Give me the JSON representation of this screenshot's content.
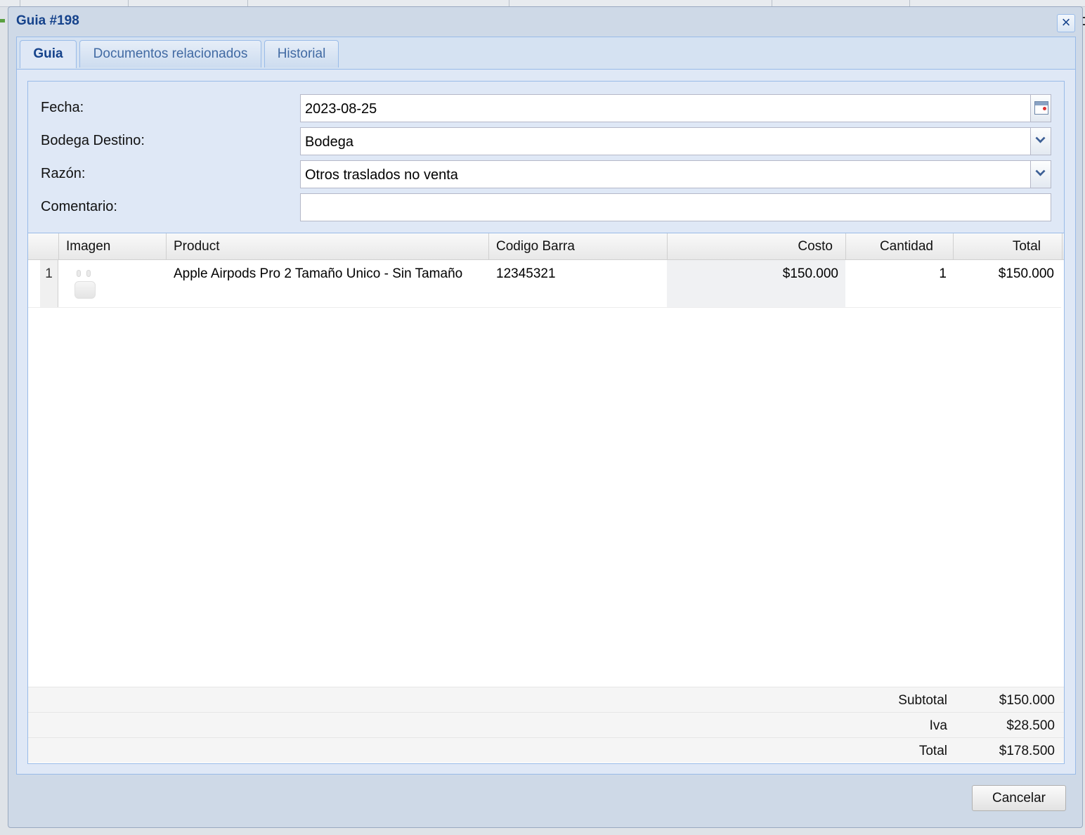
{
  "window": {
    "title": "Guia #198",
    "close_icon": "close-icon"
  },
  "tabs": [
    {
      "label": "Guia",
      "active": true
    },
    {
      "label": "Documentos relacionados",
      "active": false
    },
    {
      "label": "Historial",
      "active": false
    }
  ],
  "form": {
    "fecha": {
      "label": "Fecha:",
      "value": "2023-08-25",
      "icon": "calendar-icon"
    },
    "bodega": {
      "label": "Bodega Destino:",
      "value": "Bodega",
      "icon": "chevron-down-icon"
    },
    "razon": {
      "label": "Razón:",
      "value": "Otros traslados no venta",
      "icon": "chevron-down-icon"
    },
    "comentario": {
      "label": "Comentario:",
      "value": ""
    }
  },
  "grid": {
    "columns": [
      "",
      "Imagen",
      "Product",
      "Codigo Barra",
      "Costo",
      "Cantidad",
      "Total"
    ],
    "rows": [
      {
        "num": "1",
        "image": "airpods-thumbnail",
        "product": "Apple Airpods Pro 2 Tamaño Unico - Sin Tamaño",
        "barcode": "12345321",
        "costo": "$150.000",
        "cantidad": "1",
        "total": "$150.000"
      }
    ]
  },
  "summary": {
    "subtotal_label": "Subtotal",
    "subtotal": "$150.000",
    "iva_label": "Iva",
    "iva": "$28.500",
    "total_label": "Total",
    "total": "$178.500"
  },
  "footer": {
    "cancel_label": "Cancelar"
  },
  "colors": {
    "header_blue": "#15428b",
    "panel_bg": "#dfe8f6",
    "border": "#99bbe8"
  }
}
